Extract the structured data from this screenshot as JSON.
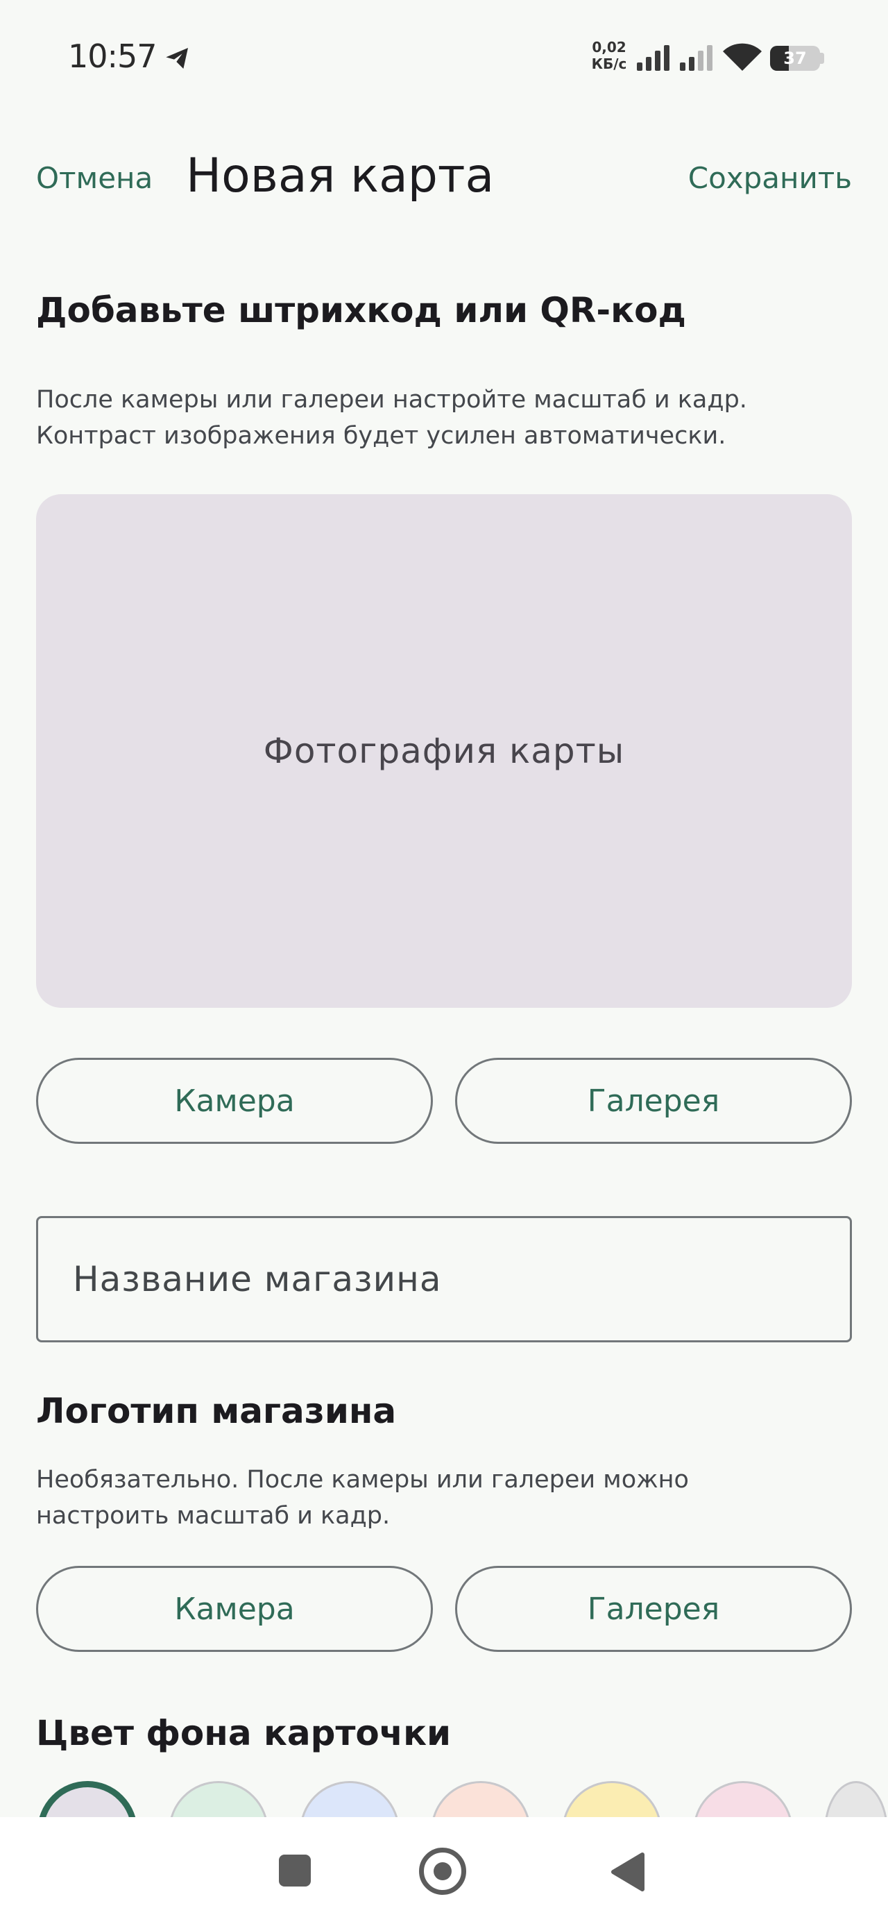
{
  "status_bar": {
    "time": "10:57",
    "net_speed_value": "0,02",
    "net_speed_unit": "КБ/с",
    "battery_level": "37",
    "telegram_icon": "telegram-icon",
    "wifi_icon": "wifi-icon"
  },
  "app_bar": {
    "cancel_label": "Отмена",
    "title": "Новая карта",
    "save_label": "Сохранить"
  },
  "barcode_section": {
    "title": "Добавьте штрихкод или QR-код",
    "helper_line1": "После камеры или галереи настройте масштаб и кадр.",
    "helper_line2": "Контраст изображения будет усилен автоматически.",
    "photo_placeholder": "Фотография карты",
    "camera_label": "Камера",
    "gallery_label": "Галерея"
  },
  "store_name": {
    "placeholder": "Название магазина",
    "value": ""
  },
  "logo_section": {
    "title": "Логотип магазина",
    "helper_line1": "Необязательно. После камеры или галереи можно",
    "helper_line2": "настроить масштаб и кадр.",
    "camera_label": "Камера",
    "gallery_label": "Галерея"
  },
  "color_section": {
    "title": "Цвет фона карточки",
    "swatches": [
      {
        "color": "#e4e0e8",
        "selected": true
      },
      {
        "color": "#dcefe3",
        "selected": false
      },
      {
        "color": "#dce6fa",
        "selected": false
      },
      {
        "color": "#fbe2d9",
        "selected": false
      },
      {
        "color": "#fbedb2",
        "selected": false
      },
      {
        "color": "#f7dde6",
        "selected": false
      },
      {
        "color": "#e6e6e6",
        "selected": false
      }
    ],
    "selected_ring_color": "#2f6b57"
  },
  "nav_bar": {
    "recents_icon": "square-icon",
    "home_icon": "circle-icon",
    "back_icon": "triangle-back-icon"
  }
}
